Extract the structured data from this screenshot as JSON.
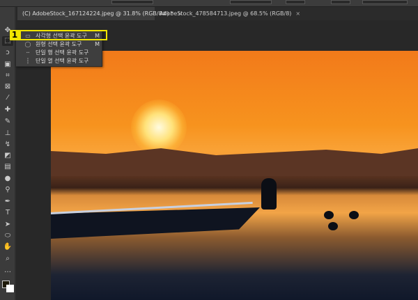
{
  "tabs": [
    {
      "label": "(C) AdobeStock_167124224.jpeg @ 31.8% (RGB/8#) *",
      "close": "×"
    },
    {
      "label": "AdobeStock_478584713.jpeg @ 68.5% (RGB/8)",
      "close": "×"
    }
  ],
  "flyout": {
    "badge": "1",
    "items": [
      {
        "label": "사각형 선택 윤곽 도구",
        "shortcut": "M",
        "icon": "▭"
      },
      {
        "label": "원형 선택 윤곽 도구",
        "shortcut": "M",
        "icon": "◯"
      },
      {
        "label": "단일 행 선택 윤곽 도구",
        "shortcut": "",
        "icon": "┄"
      },
      {
        "label": "단일 열 선택 윤곽 도구",
        "shortcut": "",
        "icon": "┆"
      }
    ]
  },
  "tools": [
    {
      "name": "move",
      "glyph": "✥"
    },
    {
      "name": "marquee",
      "glyph": "⬚"
    },
    {
      "name": "lasso",
      "glyph": "ↄ"
    },
    {
      "name": "object-select",
      "glyph": "▣"
    },
    {
      "name": "crop",
      "glyph": "⌗"
    },
    {
      "name": "frame",
      "glyph": "⊠"
    },
    {
      "name": "eyedropper",
      "glyph": "⁄"
    },
    {
      "name": "healing",
      "glyph": "✚"
    },
    {
      "name": "brush",
      "glyph": "✎"
    },
    {
      "name": "stamp",
      "glyph": "⊥"
    },
    {
      "name": "history-brush",
      "glyph": "↯"
    },
    {
      "name": "eraser",
      "glyph": "◩"
    },
    {
      "name": "gradient",
      "glyph": "▤"
    },
    {
      "name": "blur",
      "glyph": "●"
    },
    {
      "name": "dodge",
      "glyph": "⚲"
    },
    {
      "name": "pen",
      "glyph": "✒"
    },
    {
      "name": "type",
      "glyph": "T"
    },
    {
      "name": "path-select",
      "glyph": "➤"
    },
    {
      "name": "shape",
      "glyph": "⬭"
    },
    {
      "name": "hand",
      "glyph": "✋"
    },
    {
      "name": "zoom",
      "glyph": "⌕"
    },
    {
      "name": "more",
      "glyph": "…"
    }
  ]
}
